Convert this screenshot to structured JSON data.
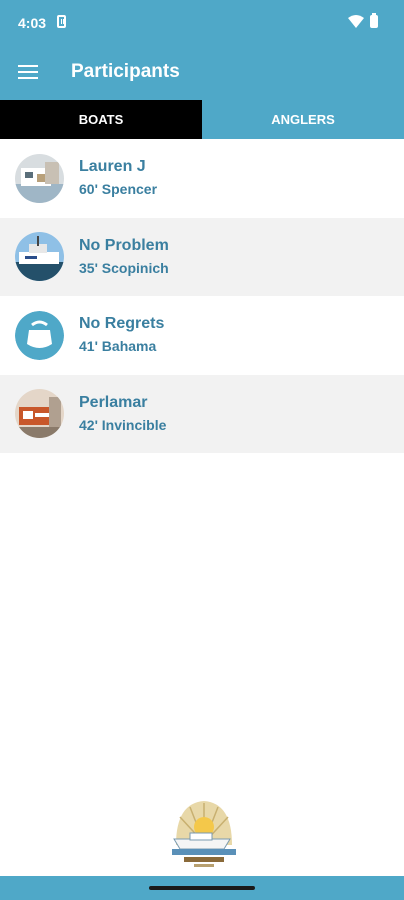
{
  "status": {
    "time": "4:03"
  },
  "appbar": {
    "title": "Participants"
  },
  "tabs": [
    {
      "label": "BOATS",
      "active": true
    },
    {
      "label": "ANGLERS",
      "active": false
    }
  ],
  "boats": [
    {
      "name": "Lauren J",
      "detail": "60' Spencer"
    },
    {
      "name": "No Problem",
      "detail": "35' Scopinich"
    },
    {
      "name": "No Regrets",
      "detail": "41' Bahama"
    },
    {
      "name": "Perlamar",
      "detail": "42' Invincible"
    }
  ],
  "colors": {
    "primary": "#4fa8c8",
    "text": "#3a7fa0",
    "active_tab": "#000000",
    "alt_row": "#f2f2f2"
  }
}
